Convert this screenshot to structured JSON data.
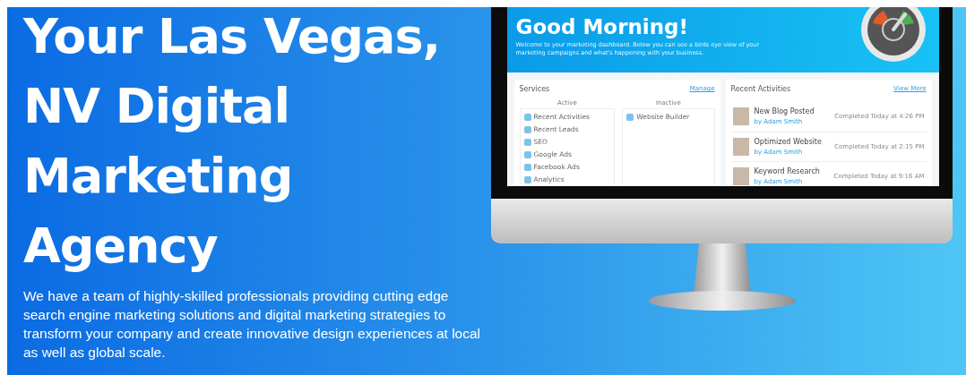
{
  "hero": {
    "headline_lines": [
      "Your Las Vegas,",
      "NV Digital",
      "Marketing",
      "Agency"
    ],
    "description": "We have a team of highly-skilled professionals providing cutting edge search engine marketing solutions and digital marketing strategies to transform your company and create innovative design experiences at local as well as global scale."
  },
  "dashboard": {
    "greeting": "Good Morning!",
    "intro": "Welcome to your marketing dashboard. Below you can see a birds eye view of your marketing campaigns and what's happening with your business.",
    "services": {
      "title": "Services",
      "action": "Manage",
      "columns": [
        {
          "heading": "Active",
          "items": [
            "Recent Activities",
            "Recent Leads",
            "SEO",
            "Google Ads",
            "Facebook Ads",
            "Analytics"
          ]
        },
        {
          "heading": "Inactive",
          "items": [
            "Website Builder"
          ]
        }
      ]
    },
    "recent": {
      "title": "Recent Activities",
      "action": "View More",
      "items": [
        {
          "title": "New Blog Posted",
          "author": "by Adam Smith",
          "status": "Completed Today at 4:26 PM"
        },
        {
          "title": "Optimized Website",
          "author": "by Adam Smith",
          "status": "Completed Today at 2:15 PM"
        },
        {
          "title": "Keyword Research",
          "author": "by Adam Smith",
          "status": "Completed Today at 9:16 AM"
        }
      ]
    }
  }
}
